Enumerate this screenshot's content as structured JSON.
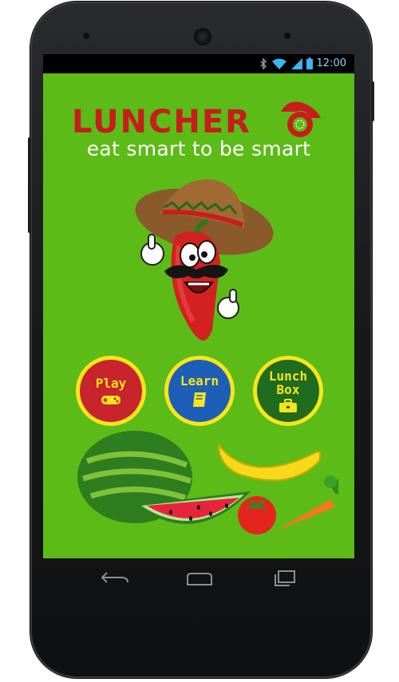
{
  "status": {
    "time": "12:00",
    "icons": [
      "bluetooth-icon",
      "wifi-icon",
      "signal-icon",
      "battery-icon"
    ]
  },
  "app": {
    "logo_text": "LUNCHER",
    "tagline": "eat smart to be smart"
  },
  "menu": {
    "play": {
      "label": "Play",
      "icon": "gamepad-icon",
      "color": "#c8242b"
    },
    "learn": {
      "label": "Learn",
      "icon": "book-icon",
      "color": "#1d5fb7"
    },
    "lunch_box": {
      "label_line1": "Lunch",
      "label_line2": "Box",
      "icon": "briefcase-icon",
      "color": "#1f6b1f"
    },
    "ring_color": "#f7e51b"
  },
  "nav": {
    "back": "back-icon",
    "home": "home-icon",
    "recents": "recents-icon"
  },
  "colors": {
    "screen_bg": "#5cbb17",
    "logo_red": "#c81d1d"
  }
}
